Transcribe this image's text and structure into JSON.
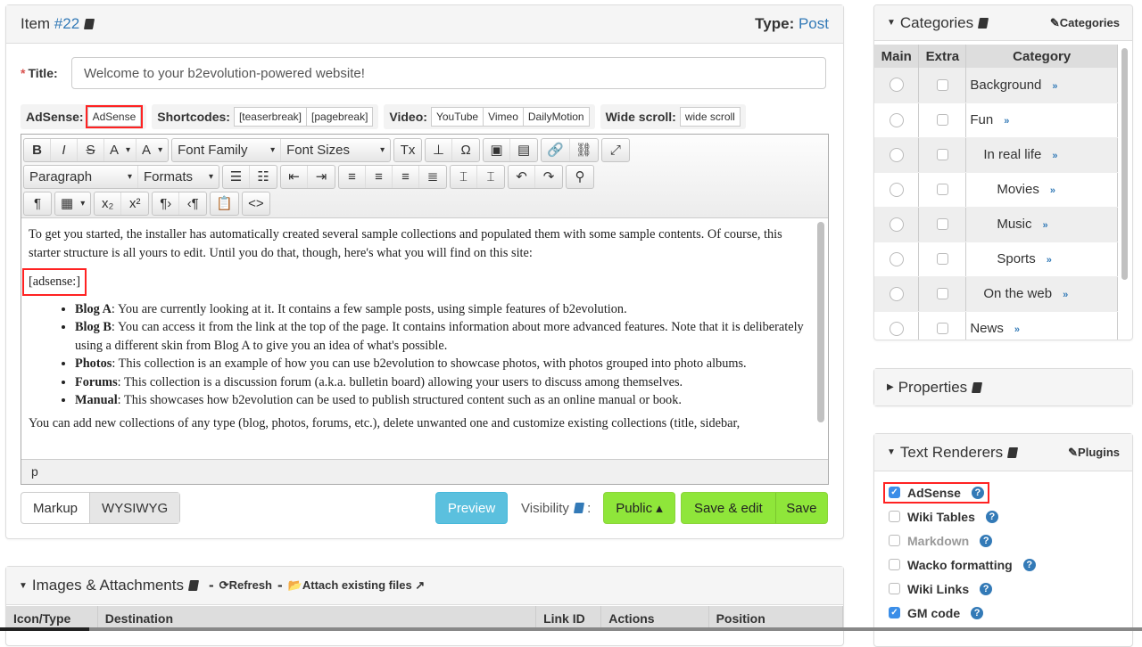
{
  "item": {
    "label": "Item",
    "id": "#22",
    "type_label": "Type:",
    "type_value": "Post"
  },
  "title": {
    "label": "Title:",
    "value": "Welcome to your b2evolution-powered website!"
  },
  "quicktags": [
    {
      "label": "AdSense:",
      "buttons": [
        "AdSense"
      ]
    },
    {
      "label": "Shortcodes:",
      "buttons": [
        "[teaserbreak]",
        "[pagebreak]"
      ]
    },
    {
      "label": "Video:",
      "buttons": [
        "YouTube",
        "Vimeo",
        "DailyMotion"
      ]
    },
    {
      "label": "Wide scroll:",
      "buttons": [
        "wide scroll"
      ]
    }
  ],
  "toolbar": {
    "rows": [
      [
        [
          "bold-icon",
          "B",
          "",
          "fw"
        ],
        [
          "italic-icon",
          "I",
          "",
          "it"
        ],
        [
          "strikethrough-icon",
          "S",
          "",
          "st"
        ],
        [
          "text-color-icon",
          "A",
          "dd"
        ],
        [
          "background-color-icon",
          "A",
          "dd"
        ]
      ],
      [
        [
          "font-family-select",
          "Font Family",
          "dd"
        ],
        [
          "font-sizes-select",
          "Font Sizes",
          "dd"
        ]
      ],
      [
        [
          "clear-formatting-icon",
          "Tx"
        ]
      ],
      [
        [
          "insert-icon",
          "⊥"
        ],
        [
          "special-char-icon",
          "Ω"
        ]
      ],
      [
        [
          "image-icon",
          "▣"
        ],
        [
          "media-icon",
          "▤"
        ]
      ],
      [
        [
          "link-icon",
          "🔗"
        ],
        [
          "unlink-icon",
          "⛓"
        ]
      ],
      [
        [
          "fullscreen-icon",
          "⤢"
        ]
      ],
      "|",
      [
        [
          "paragraph-select",
          "Paragraph",
          "dd"
        ],
        [
          "formats-select",
          "Formats",
          "dd"
        ]
      ],
      [
        [
          "bullet-list-icon",
          "☰"
        ],
        [
          "numbered-list-icon",
          "☷"
        ]
      ],
      [
        [
          "outdent-icon",
          "⇤"
        ],
        [
          "indent-icon",
          "⇥"
        ]
      ],
      [
        [
          "align-left-icon",
          "≡"
        ],
        [
          "align-center-icon",
          "≡"
        ],
        [
          "align-right-icon",
          "≡"
        ],
        [
          "align-justify-icon",
          "≣"
        ]
      ],
      [
        [
          "page-break-icon",
          "⌶"
        ],
        [
          "horizontal-rule-icon",
          "⌶"
        ]
      ],
      [
        [
          "undo-icon",
          "↶"
        ],
        [
          "redo-icon",
          "↷"
        ]
      ],
      [
        [
          "find-replace-icon",
          "⚲"
        ]
      ],
      "|",
      [
        [
          "show-blocks-icon",
          "¶"
        ]
      ],
      [
        [
          "table-icon",
          "▦",
          "dd"
        ]
      ],
      [
        [
          "subscript-icon",
          "x₂"
        ],
        [
          "superscript-icon",
          "x²"
        ]
      ],
      [
        [
          "ltr-icon",
          "¶›"
        ],
        [
          "rtl-icon",
          "‹¶"
        ]
      ],
      [
        [
          "paste-text-icon",
          "📋"
        ]
      ],
      [
        [
          "source-code-icon",
          "<>"
        ]
      ]
    ]
  },
  "content": {
    "intro": "To get you started, the installer has automatically created several sample collections and populated them with some sample contents. Of course, this starter structure is all yours to edit. Until you do that, though, here's what you will find on this site:",
    "tag": "[adsense:]",
    "bullets": [
      {
        "b": "Blog A",
        "t": ": You are currently looking at it. It contains a few sample posts, using simple features of b2evolution."
      },
      {
        "b": "Blog B",
        "t": ": You can access it from the link at the top of the page. It contains information about more advanced features. Note that it is deliberately using a different skin from Blog A to give you an idea of what's possible."
      },
      {
        "b": "Photos",
        "t": ": This collection is an example of how you can use b2evolution to showcase photos, with photos grouped into photo albums."
      },
      {
        "b": "Forums",
        "t": ": This collection is a discussion forum (a.k.a. bulletin board) allowing your users to discuss among themselves."
      },
      {
        "b": "Manual",
        "t": ": This showcases how b2evolution can be used to publish structured content such as an online manual or book."
      }
    ],
    "outro": "You can add new collections of any type (blog, photos, forums, etc.), delete unwanted one and customize existing collections (title, sidebar,",
    "status_path": "p"
  },
  "actions": {
    "markup": "Markup",
    "wysiwyg": "WYSIWYG",
    "preview": "Preview",
    "visibility": "Visibility",
    "colon": ":",
    "public": "Public ▴",
    "save_edit": "Save & edit",
    "save": "Save"
  },
  "attachments": {
    "title": "Images & Attachments",
    "sep": "-",
    "refresh": "Refresh",
    "attach": "Attach existing files",
    "columns": [
      "Icon/Type",
      "Destination",
      "Link ID",
      "Actions",
      "Position"
    ]
  },
  "categories": {
    "title": "Categories",
    "edit_link": "Categories",
    "columns": [
      "Main",
      "Extra",
      "Category"
    ],
    "rows": [
      {
        "name": "Background",
        "level": 0
      },
      {
        "name": "Fun",
        "level": 0
      },
      {
        "name": "In real life",
        "level": 1
      },
      {
        "name": "Movies",
        "level": 2
      },
      {
        "name": "Music",
        "level": 2
      },
      {
        "name": "Sports",
        "level": 2
      },
      {
        "name": "On the web",
        "level": 1
      },
      {
        "name": "News",
        "level": 0
      }
    ],
    "more": "»"
  },
  "properties": {
    "title": "Properties"
  },
  "renderers": {
    "title": "Text Renderers",
    "edit_link": "Plugins",
    "items": [
      {
        "name": "AdSense",
        "checked": true,
        "hl": true
      },
      {
        "name": "Wiki Tables",
        "checked": false
      },
      {
        "name": "Markdown",
        "checked": false,
        "disabled": true
      },
      {
        "name": "Wacko formatting",
        "checked": false
      },
      {
        "name": "Wiki Links",
        "checked": false
      },
      {
        "name": "GM code",
        "checked": true
      }
    ],
    "help": "?"
  },
  "colors": {
    "link": "#337ab7",
    "green": "#8fe63a",
    "preview": "#5bc0de",
    "highlight": "#ff2222"
  }
}
